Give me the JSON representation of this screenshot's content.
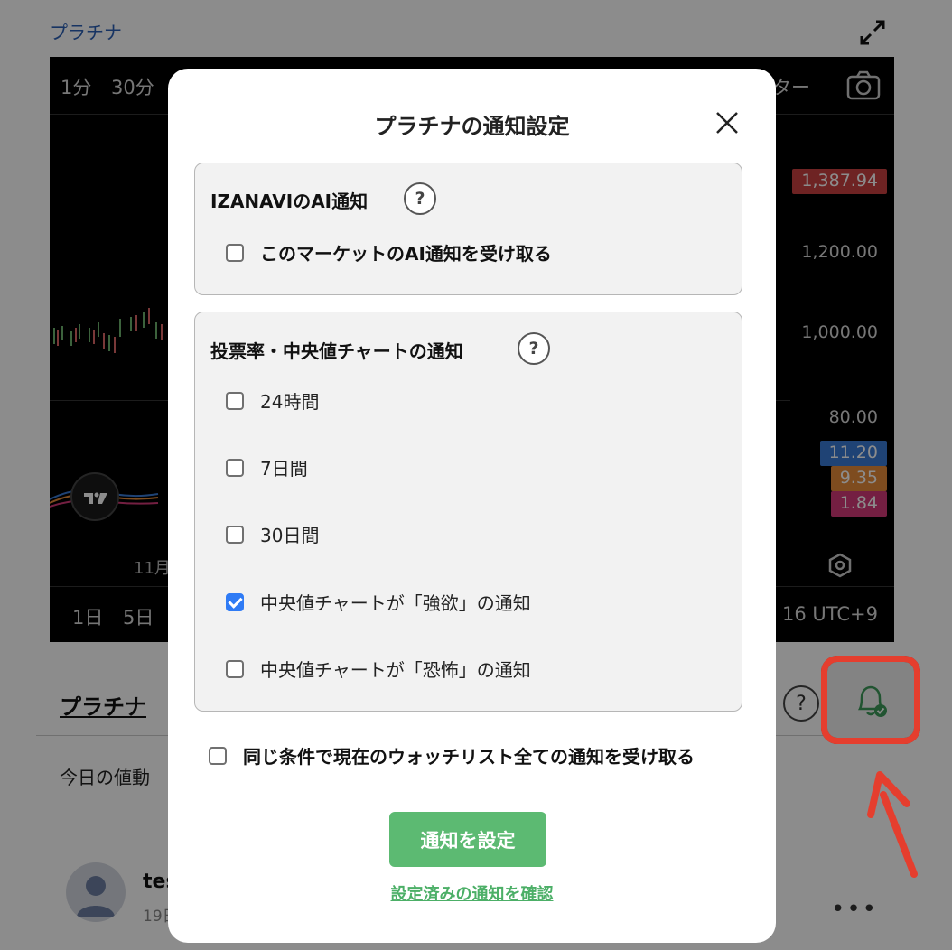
{
  "page": {
    "asset_link": "プラチナ",
    "timeframes": [
      "1分",
      "30分"
    ],
    "indicator_label": "ター",
    "price_labels": [
      "1,387.94",
      "1,200.00",
      "1,000.00",
      "80.00"
    ],
    "indicator_values": [
      "11.20",
      "9.35",
      "1.84"
    ],
    "x_tick": "11月",
    "ranges": [
      "1日",
      "5日"
    ],
    "timezone": "16 UTC+9"
  },
  "panel": {
    "title": "プラチナ",
    "subtitle": "今日の値動",
    "help": "?"
  },
  "post": {
    "user": "tes",
    "time": "19日"
  },
  "colors": {
    "price_red": "#c94141",
    "tag_blue": "#3a7bd5",
    "tag_orange": "#e68a3a",
    "tag_pink": "#d43a78",
    "accent_green": "#5cba72",
    "highlight_red": "#e53e2e"
  },
  "modal": {
    "title": "プラチナの通知設定",
    "ai_section": {
      "heading": "IZANAVIのAI通知",
      "help": "?",
      "option": "このマーケットのAI通知を受け取る"
    },
    "vote_section": {
      "heading": "投票率・中央値チャートの通知",
      "help": "?",
      "options": [
        {
          "label": "24時間",
          "checked": false
        },
        {
          "label": "7日間",
          "checked": false
        },
        {
          "label": "30日間",
          "checked": false
        },
        {
          "label": "中央値チャートが「強欲」の通知",
          "checked": true
        },
        {
          "label": "中央値チャートが「恐怖」の通知",
          "checked": false
        }
      ]
    },
    "watchlist_option": "同じ条件で現在のウォッチリスト全ての通知を受け取る",
    "submit_label": "通知を設定",
    "check_link": "設定済みの通知を確認"
  }
}
